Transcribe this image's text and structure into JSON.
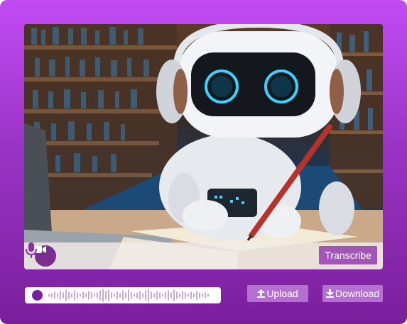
{
  "controls": {
    "transcribe_label": "Transcribe",
    "camera_icon": "video-camera-icon",
    "mic_icon": "microphone-icon"
  },
  "audio": {
    "play_icon": "record-dot-icon",
    "waveform_icon": "waveform-icon"
  },
  "actions": {
    "upload_label": "Upload",
    "download_label": "Download",
    "upload_icon": "upload-icon",
    "download_icon": "download-icon"
  },
  "colors": {
    "gradient_top": "#c24bf4",
    "gradient_bottom": "#7a1f9c",
    "accent": "#7b1fa2",
    "button": "#b46fd1"
  }
}
